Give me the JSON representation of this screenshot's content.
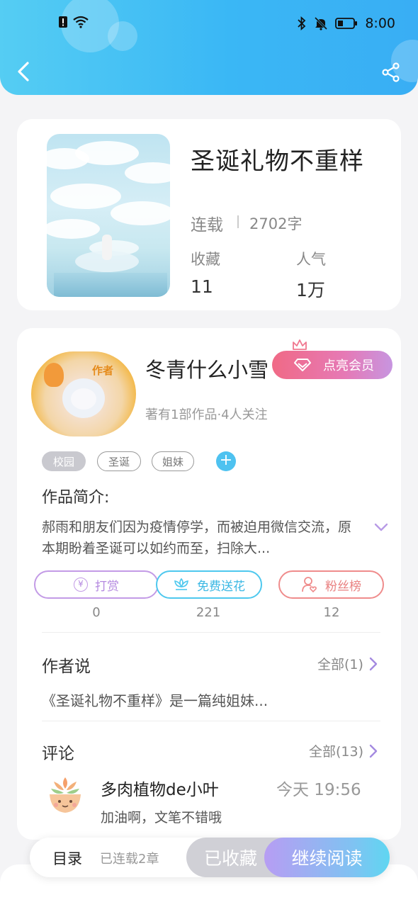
{
  "status_bar": {
    "time": "8:00"
  },
  "book": {
    "title": "圣诞礼物不重样",
    "serial_status": "连载",
    "word_count": "2702字",
    "favorites_label": "收藏",
    "favorites_value": "11",
    "popularity_label": "人气",
    "popularity_value": "1万"
  },
  "author": {
    "name": "冬青什么小雪",
    "badge_text": "作者",
    "vip_label": "点亮会员",
    "meta": "著有1部作品·4人关注",
    "tags": [
      "校园",
      "圣诞",
      "姐妹"
    ],
    "add_tag": "+"
  },
  "intro": {
    "label": "作品简介:",
    "text": "郝雨和朋友们因为疫情停学，而被迫用微信交流，原本期盼着圣诞可以如约而至，扫除大..."
  },
  "actions": {
    "tip_label": "打赏",
    "tip_icon_text": "¥",
    "tip_count": "0",
    "flower_label": "免费送花",
    "flower_count": "221",
    "fans_label": "粉丝榜",
    "fans_count": "12"
  },
  "author_says": {
    "title": "作者说",
    "see_all": "全部(1)",
    "text": "《圣诞礼物不重样》是一篇纯姐妹..."
  },
  "comments": {
    "title": "评论",
    "see_all": "全部(13)",
    "items": [
      {
        "user": "多肉植物de小叶",
        "time": "今天 19:56",
        "text": "加油啊，文笔不错哦"
      }
    ]
  },
  "bottom_bar": {
    "toc_label": "目录",
    "chapters_label": "已连载2章",
    "collected_label": "已收藏",
    "continue_label": "继续阅读"
  },
  "colors": {
    "header_gradient_start": "#55cdf3",
    "header_gradient_end": "#39aef4",
    "tip_color": "#c39be6",
    "flower_color": "#4ec8ee",
    "fans_color": "#ef8c8c"
  }
}
